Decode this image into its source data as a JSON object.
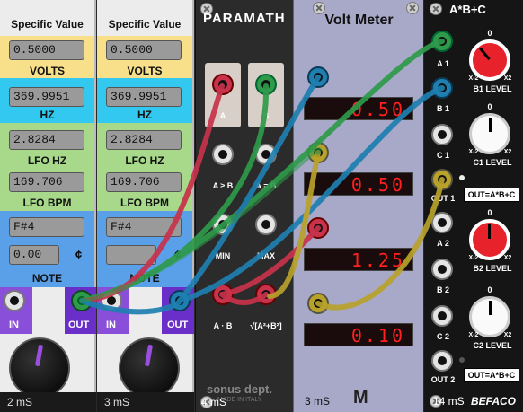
{
  "sv1": {
    "title": "Specific Value",
    "volts_value": "0.5000",
    "volts_label": "VOLTS",
    "hz_value": "369.9951",
    "hz_label": "HZ",
    "lfohz_value": "2.8284",
    "lfohz_label": "LFO HZ",
    "lfobpm_value": "169.706",
    "lfobpm_label": "LFO BPM",
    "note_value": "F#4",
    "cents_value": "0.00",
    "cents_symbol": "¢",
    "note_label": "NOTE",
    "in_label": "IN",
    "out_label": "OUT",
    "footer": "2 mS"
  },
  "sv2": {
    "title": "Specific Value",
    "volts_value": "0.5000",
    "volts_label": "VOLTS",
    "hz_value": "369.9951",
    "hz_label": "HZ",
    "lfohz_value": "2.8284",
    "lfohz_label": "LFO HZ",
    "lfobpm_value": "169.706",
    "lfobpm_label": "LFO BPM",
    "note_value": "F#4",
    "cents_value": "",
    "cents_symbol": "¢",
    "note_label": "NOTE",
    "in_label": "IN",
    "out_label": "OUT",
    "footer": "3 mS"
  },
  "paramath": {
    "title": "PARAMATH",
    "a": "A",
    "b": "B",
    "a_ge_b": "A ≥ B",
    "a_eq_b": "A = B",
    "min": "MIN",
    "max": "MAX",
    "a_times_b": "A · B",
    "hypot": "√[A²+B²]",
    "brand": "sonus dept.",
    "brand_sub": "MADE IN ITALY",
    "footer": "4 mS"
  },
  "voltmeter": {
    "title": "Volt Meter",
    "displays": [
      "0.50",
      "0.50",
      "1.25",
      "0.10"
    ],
    "footer": "3 mS",
    "logo": "M"
  },
  "abc": {
    "title": "A*B+C",
    "a1": "A 1",
    "b1": "B 1",
    "c1": "C 1",
    "out1": "OUT 1",
    "b1_level": "B1 LEVEL",
    "c1_level": "C1 LEVEL",
    "out1_formula": "OUT=A*B+C",
    "a2": "A 2",
    "b2": "B 2",
    "c2": "C 2",
    "out2": "OUT 2",
    "b2_level": "B2 LEVEL",
    "c2_level": "C2 LEVEL",
    "out2_formula": "OUT=A*B+C",
    "knob_min": "X-2",
    "knob_max": "X2",
    "knob_zero": "0",
    "footer": "14 mS",
    "brand": "BEFACO"
  },
  "colors": {
    "yellow": "#f8e08a",
    "cyan": "#33c8f0",
    "green": "#a8d88a",
    "blue": "#5aa0e8",
    "purple": "#8a4fd8",
    "cable_red": "#c8324a",
    "cable_green": "#2e9a4a",
    "cable_blue": "#1e7fb0",
    "cable_yellow": "#b8a22a"
  }
}
